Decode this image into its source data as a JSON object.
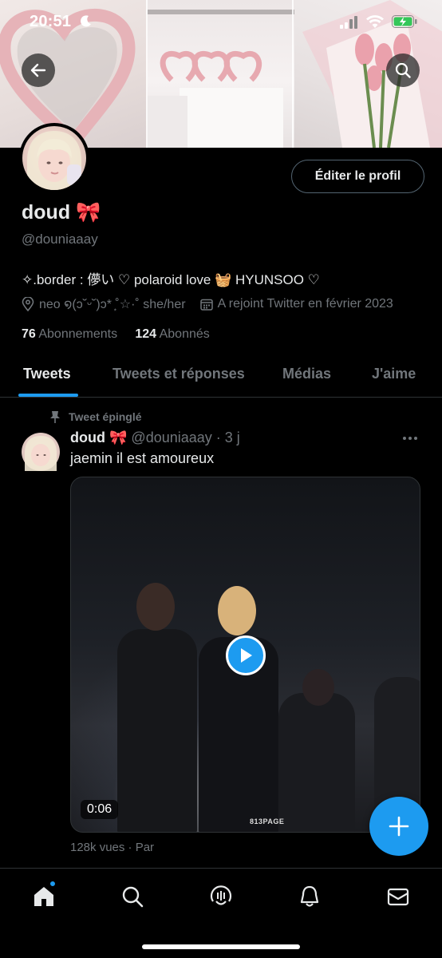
{
  "status_bar": {
    "time": "20:51"
  },
  "header": {
    "back_icon": "arrow-left-icon",
    "search_icon": "search-icon"
  },
  "profile": {
    "edit_button": "Éditer le profil",
    "name": "doud 🎀",
    "handle": "@douniaaay",
    "bio": "✧.border : 儚い ♡ polaroid love 🧺 HYUNSOO ♡",
    "location": "neo ໑(ↄ˘ᵕ˘)ↄ* ͙˚☆·˚ she/her",
    "joined": "A rejoint Twitter en février 2023",
    "following_count": "76",
    "following_label": "Abonnements",
    "followers_count": "124",
    "followers_label": "Abonnés"
  },
  "tabs": [
    {
      "label": "Tweets",
      "active": true
    },
    {
      "label": "Tweets et réponses",
      "active": false
    },
    {
      "label": "Médias",
      "active": false
    },
    {
      "label": "J'aime",
      "active": false
    }
  ],
  "tweet": {
    "pinned_label": "Tweet épinglé",
    "author_name": "doud 🎀",
    "author_handle": "@douniaaay",
    "time": "· 3 j",
    "text": "jaemin il est amoureux",
    "video_duration": "0:06",
    "video_watermark": "813PAGE",
    "views": "128k vues · Par"
  },
  "colors": {
    "accent": "#1d9bf0",
    "background": "#000000",
    "secondary_text": "#71767b"
  },
  "bottom_nav": [
    "home-icon",
    "search-icon",
    "spaces-icon",
    "notifications-icon",
    "messages-icon"
  ]
}
